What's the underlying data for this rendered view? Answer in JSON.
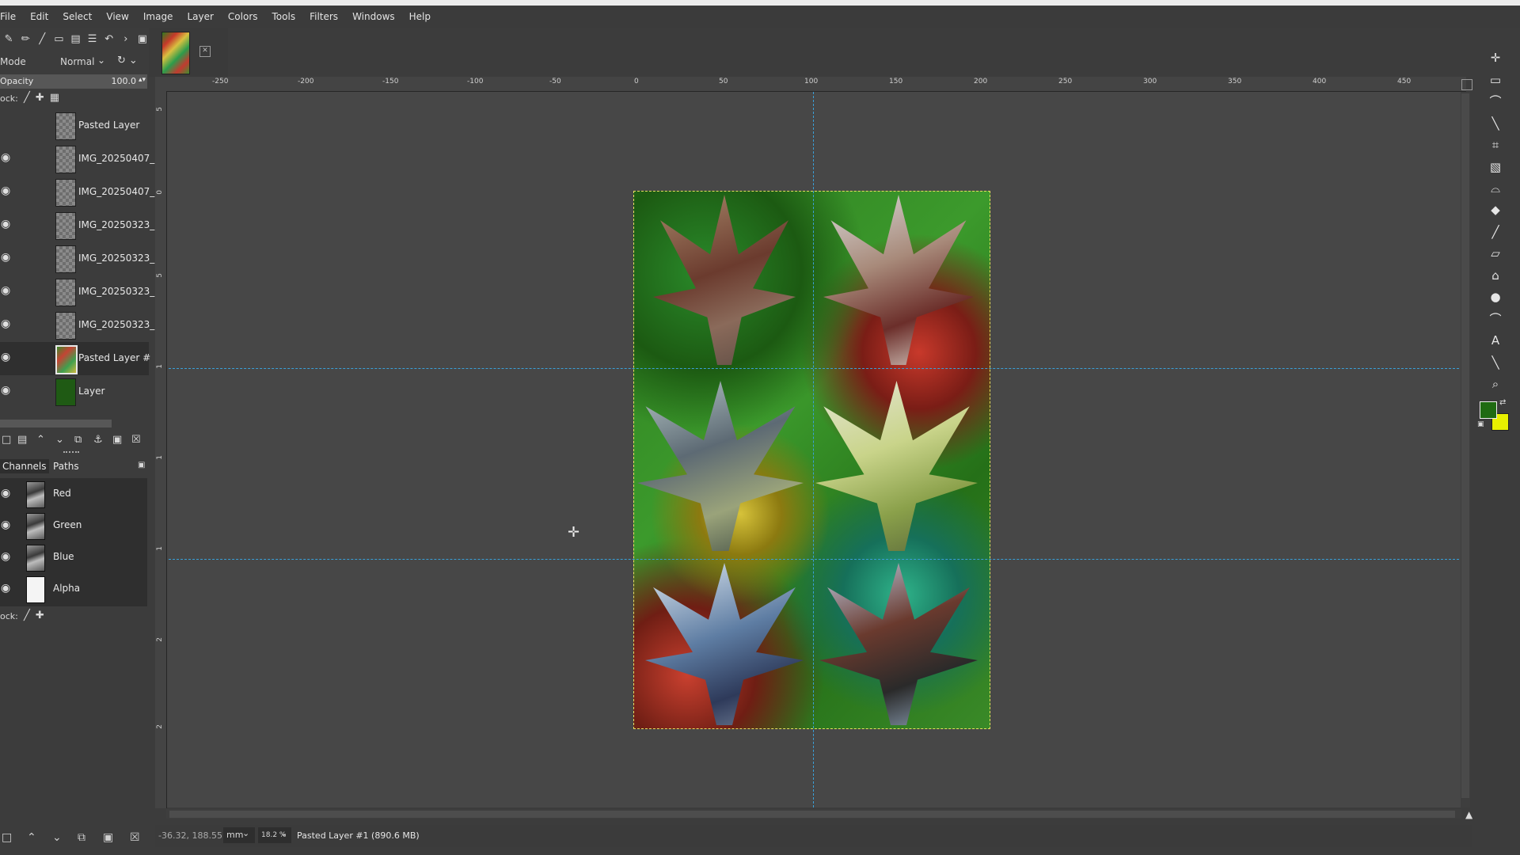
{
  "menu": [
    "File",
    "Edit",
    "Select",
    "View",
    "Image",
    "Layer",
    "Colors",
    "Tools",
    "Filters",
    "Windows",
    "Help"
  ],
  "layers_panel": {
    "mode_label": "Mode",
    "mode_value": "Normal",
    "opacity_label": "Opacity",
    "opacity_value": "100.0",
    "lock_label": "ock:",
    "layers": [
      {
        "name": "Pasted Layer",
        "visible": false
      },
      {
        "name": "IMG_20250407_",
        "visible": true
      },
      {
        "name": "IMG_20250407_",
        "visible": true
      },
      {
        "name": "IMG_20250323_",
        "visible": true
      },
      {
        "name": "IMG_20250323_",
        "visible": true
      },
      {
        "name": "IMG_20250323_",
        "visible": true
      },
      {
        "name": "IMG_20250323_",
        "visible": true
      },
      {
        "name": "Pasted Layer #",
        "visible": true,
        "active": true
      },
      {
        "name": "Layer",
        "visible": true
      }
    ]
  },
  "channels_panel": {
    "tabs": [
      "Channels",
      "Paths"
    ],
    "channels": [
      {
        "name": "Red"
      },
      {
        "name": "Green"
      },
      {
        "name": "Blue"
      },
      {
        "name": "Alpha"
      }
    ],
    "lock_label": "ock:"
  },
  "ruler": {
    "labels": [
      "-250",
      "-200",
      "-150",
      "-100",
      "-50",
      "0",
      "50",
      "100",
      "150",
      "200",
      "250",
      "300",
      "350",
      "400",
      "450"
    ],
    "vertical_labels": [
      "5",
      "0",
      "5",
      "1",
      "1",
      "1",
      "2",
      "2",
      "2",
      "3"
    ]
  },
  "statusbar": {
    "coords": "-36.32, 188.55",
    "unit": "mm",
    "zoom": "18.2 %",
    "message": "Pasted Layer #1 (890.6 MB)"
  },
  "colors": {
    "foreground": "#1f6b12",
    "background": "#e8f000",
    "guide": "#3aa0d8"
  }
}
